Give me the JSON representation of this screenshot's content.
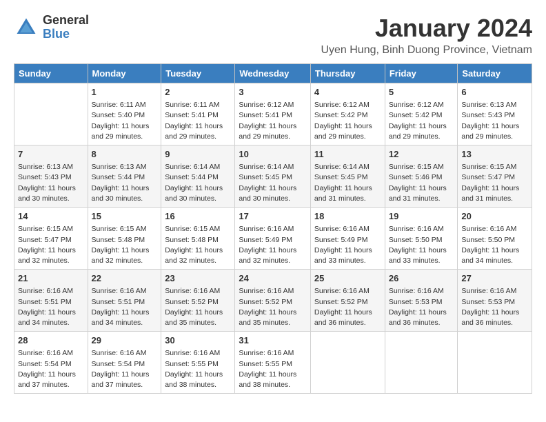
{
  "logo": {
    "general": "General",
    "blue": "Blue"
  },
  "title": "January 2024",
  "subtitle": "Uyen Hung, Binh Duong Province, Vietnam",
  "days_header": [
    "Sunday",
    "Monday",
    "Tuesday",
    "Wednesday",
    "Thursday",
    "Friday",
    "Saturday"
  ],
  "weeks": [
    [
      {
        "day": "",
        "info": ""
      },
      {
        "day": "1",
        "info": "Sunrise: 6:11 AM\nSunset: 5:40 PM\nDaylight: 11 hours\nand 29 minutes."
      },
      {
        "day": "2",
        "info": "Sunrise: 6:11 AM\nSunset: 5:41 PM\nDaylight: 11 hours\nand 29 minutes."
      },
      {
        "day": "3",
        "info": "Sunrise: 6:12 AM\nSunset: 5:41 PM\nDaylight: 11 hours\nand 29 minutes."
      },
      {
        "day": "4",
        "info": "Sunrise: 6:12 AM\nSunset: 5:42 PM\nDaylight: 11 hours\nand 29 minutes."
      },
      {
        "day": "5",
        "info": "Sunrise: 6:12 AM\nSunset: 5:42 PM\nDaylight: 11 hours\nand 29 minutes."
      },
      {
        "day": "6",
        "info": "Sunrise: 6:13 AM\nSunset: 5:43 PM\nDaylight: 11 hours\nand 29 minutes."
      }
    ],
    [
      {
        "day": "7",
        "info": "Sunrise: 6:13 AM\nSunset: 5:43 PM\nDaylight: 11 hours\nand 30 minutes."
      },
      {
        "day": "8",
        "info": "Sunrise: 6:13 AM\nSunset: 5:44 PM\nDaylight: 11 hours\nand 30 minutes."
      },
      {
        "day": "9",
        "info": "Sunrise: 6:14 AM\nSunset: 5:44 PM\nDaylight: 11 hours\nand 30 minutes."
      },
      {
        "day": "10",
        "info": "Sunrise: 6:14 AM\nSunset: 5:45 PM\nDaylight: 11 hours\nand 30 minutes."
      },
      {
        "day": "11",
        "info": "Sunrise: 6:14 AM\nSunset: 5:45 PM\nDaylight: 11 hours\nand 31 minutes."
      },
      {
        "day": "12",
        "info": "Sunrise: 6:15 AM\nSunset: 5:46 PM\nDaylight: 11 hours\nand 31 minutes."
      },
      {
        "day": "13",
        "info": "Sunrise: 6:15 AM\nSunset: 5:47 PM\nDaylight: 11 hours\nand 31 minutes."
      }
    ],
    [
      {
        "day": "14",
        "info": "Sunrise: 6:15 AM\nSunset: 5:47 PM\nDaylight: 11 hours\nand 32 minutes."
      },
      {
        "day": "15",
        "info": "Sunrise: 6:15 AM\nSunset: 5:48 PM\nDaylight: 11 hours\nand 32 minutes."
      },
      {
        "day": "16",
        "info": "Sunrise: 6:15 AM\nSunset: 5:48 PM\nDaylight: 11 hours\nand 32 minutes."
      },
      {
        "day": "17",
        "info": "Sunrise: 6:16 AM\nSunset: 5:49 PM\nDaylight: 11 hours\nand 32 minutes."
      },
      {
        "day": "18",
        "info": "Sunrise: 6:16 AM\nSunset: 5:49 PM\nDaylight: 11 hours\nand 33 minutes."
      },
      {
        "day": "19",
        "info": "Sunrise: 6:16 AM\nSunset: 5:50 PM\nDaylight: 11 hours\nand 33 minutes."
      },
      {
        "day": "20",
        "info": "Sunrise: 6:16 AM\nSunset: 5:50 PM\nDaylight: 11 hours\nand 34 minutes."
      }
    ],
    [
      {
        "day": "21",
        "info": "Sunrise: 6:16 AM\nSunset: 5:51 PM\nDaylight: 11 hours\nand 34 minutes."
      },
      {
        "day": "22",
        "info": "Sunrise: 6:16 AM\nSunset: 5:51 PM\nDaylight: 11 hours\nand 34 minutes."
      },
      {
        "day": "23",
        "info": "Sunrise: 6:16 AM\nSunset: 5:52 PM\nDaylight: 11 hours\nand 35 minutes."
      },
      {
        "day": "24",
        "info": "Sunrise: 6:16 AM\nSunset: 5:52 PM\nDaylight: 11 hours\nand 35 minutes."
      },
      {
        "day": "25",
        "info": "Sunrise: 6:16 AM\nSunset: 5:52 PM\nDaylight: 11 hours\nand 36 minutes."
      },
      {
        "day": "26",
        "info": "Sunrise: 6:16 AM\nSunset: 5:53 PM\nDaylight: 11 hours\nand 36 minutes."
      },
      {
        "day": "27",
        "info": "Sunrise: 6:16 AM\nSunset: 5:53 PM\nDaylight: 11 hours\nand 36 minutes."
      }
    ],
    [
      {
        "day": "28",
        "info": "Sunrise: 6:16 AM\nSunset: 5:54 PM\nDaylight: 11 hours\nand 37 minutes."
      },
      {
        "day": "29",
        "info": "Sunrise: 6:16 AM\nSunset: 5:54 PM\nDaylight: 11 hours\nand 37 minutes."
      },
      {
        "day": "30",
        "info": "Sunrise: 6:16 AM\nSunset: 5:55 PM\nDaylight: 11 hours\nand 38 minutes."
      },
      {
        "day": "31",
        "info": "Sunrise: 6:16 AM\nSunset: 5:55 PM\nDaylight: 11 hours\nand 38 minutes."
      },
      {
        "day": "",
        "info": ""
      },
      {
        "day": "",
        "info": ""
      },
      {
        "day": "",
        "info": ""
      }
    ]
  ]
}
